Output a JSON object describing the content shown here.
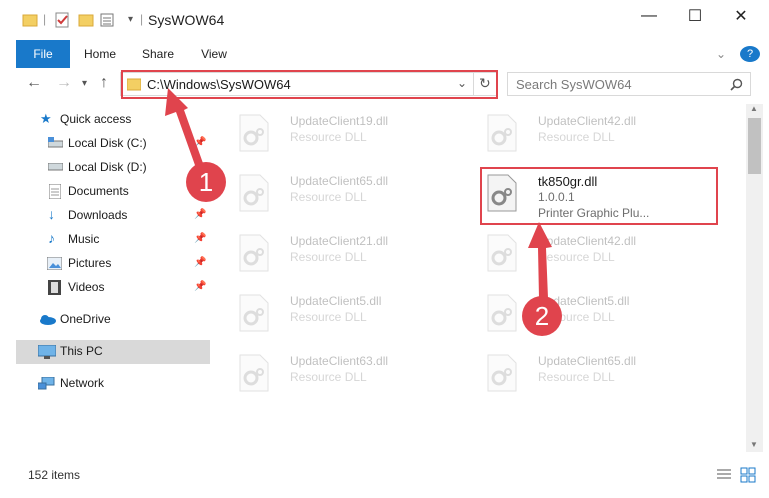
{
  "window": {
    "title": "SysWOW64",
    "buttons": {
      "minimize": "—",
      "maximize": "☐",
      "close": "✕"
    }
  },
  "ribbon": {
    "tabs": [
      "File",
      "Home",
      "Share",
      "View"
    ],
    "help": "?"
  },
  "address": {
    "path": "C:\\Windows\\SysWOW64",
    "search_placeholder": "Search SysWOW64"
  },
  "nav_pane": {
    "items": [
      {
        "label": "Quick access",
        "icon": "star-icon",
        "pinned": false
      },
      {
        "label": "Local Disk (C:)",
        "icon": "drive-icon",
        "pinned": true
      },
      {
        "label": "Local Disk (D:)",
        "icon": "drive-icon",
        "pinned": false
      },
      {
        "label": "Documents",
        "icon": "document-icon",
        "pinned": false
      },
      {
        "label": "Downloads",
        "icon": "download-icon",
        "pinned": true
      },
      {
        "label": "Music",
        "icon": "music-icon",
        "pinned": true
      },
      {
        "label": "Pictures",
        "icon": "pictures-icon",
        "pinned": true
      },
      {
        "label": "Videos",
        "icon": "videos-icon",
        "pinned": true
      },
      {
        "label": "OneDrive",
        "icon": "cloud-icon",
        "pinned": false
      },
      {
        "label": "This PC",
        "icon": "computer-icon",
        "pinned": false,
        "selected": true
      },
      {
        "label": "Network",
        "icon": "network-icon",
        "pinned": false
      }
    ]
  },
  "files": [
    {
      "name": "UpdateClient19.dll",
      "desc": "Resource DLL",
      "dim": true
    },
    {
      "name": "UpdateClient42.dll",
      "desc": "Resource DLL",
      "dim": true
    },
    {
      "name": "UpdateClient65.dll",
      "desc": "Resource DLL",
      "dim": true
    },
    {
      "name": "tk850gr.dll",
      "desc": "1.0.0.1",
      "desc2": "Printer Graphic Plu...",
      "dim": false
    },
    {
      "name": "UpdateClient21.dll",
      "desc": "Resource DLL",
      "dim": true
    },
    {
      "name": "UpdateClient42.dll",
      "desc": "Resource DLL",
      "dim": true
    },
    {
      "name": "UpdateClient5.dll",
      "desc": "Resource DLL",
      "dim": true
    },
    {
      "name": "UpdateClient5.dll",
      "desc": "Resource DLL",
      "dim": true
    },
    {
      "name": "UpdateClient63.dll",
      "desc": "Resource DLL",
      "dim": true
    },
    {
      "name": "UpdateClient65.dll",
      "desc": "Resource DLL",
      "dim": true
    }
  ],
  "status": {
    "item_count": "152 items"
  },
  "annotations": {
    "step1": "1",
    "step2": "2",
    "color": "#e0444d"
  }
}
